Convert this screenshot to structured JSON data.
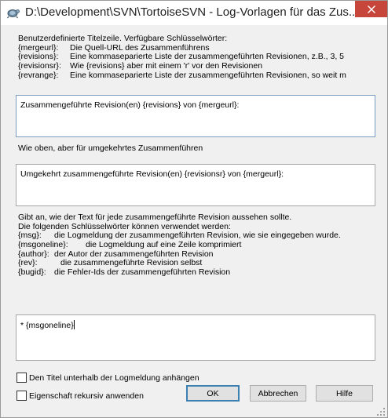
{
  "window": {
    "title": "D:\\Development\\SVN\\TortoiseSVN - Log-Vorlagen für das Zus...",
    "close_glyph": "✕"
  },
  "title_section": {
    "intro": "Benutzerdefinierte Titelzeile. Verfügbare Schlüsselwörter:",
    "keywords": [
      {
        "key": "{mergeurl}:",
        "desc": "Die Quell-URL des Zusammenführens"
      },
      {
        "key": "{revisions}:",
        "desc": "Eine kommaseparierte Liste der zusammengeführten Revisionen, z.B., 3, 5"
      },
      {
        "key": "{revisionsr}:",
        "desc": "Wie {revisions} aber mit einem 'r' vor den Revisionen"
      },
      {
        "key": "{revrange}:",
        "desc": "Eine kommaseparierte Liste der zusammengeführten Revisionen, so weit m"
      }
    ],
    "value": "Zusammengeführte Revision(en) {revisions} von {mergeurl}:"
  },
  "reverse_section": {
    "label": "Wie oben, aber für umgekehrtes Zusammenführen",
    "value": "Umgekehrt zusammengeführte Revision(en) {revisionsr} von {mergeurl}:"
  },
  "per_revision_section": {
    "intro_line1": "Gibt an, wie der Text für jede zusammengeführte Revision aussehen sollte.",
    "intro_line2": "Die folgenden Schlüsselwörter können verwendet werden:",
    "keywords": [
      {
        "key": "{msg}:",
        "desc": "die Logmeldung der zusammengeführten Revision, wie sie eingegeben wurde."
      },
      {
        "key": "{msgoneline}:",
        "desc": "die Logmeldung auf eine Zeile komprimiert"
      },
      {
        "key": "{author}:",
        "desc": "der Autor der zusammengeführten Revision"
      },
      {
        "key": "{rev}:",
        "desc": "die zusammengeführte Revision selbst"
      },
      {
        "key": "{bugid}:",
        "desc": "die Fehler-Ids der zusammengeführten Revision"
      }
    ],
    "value": "* {msgoneline}"
  },
  "options": {
    "title_below_label": "Den Titel unterhalb der Logmeldung anhängen",
    "recursive_label": "Eigenschaft rekursiv anwenden"
  },
  "buttons": {
    "ok": "OK",
    "cancel": "Abbrechen",
    "help": "Hilfe"
  },
  "colors": {
    "close_button": "#c7463b",
    "focus_border": "#7a9cc0",
    "default_button_border": "#3c7fb1"
  }
}
